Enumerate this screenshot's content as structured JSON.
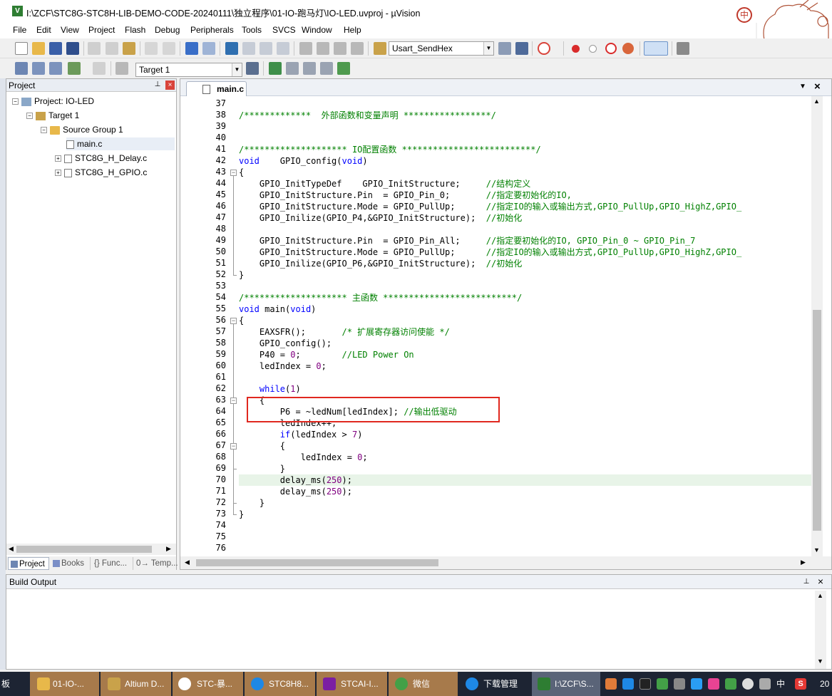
{
  "window": {
    "title": "I:\\ZCF\\STC8G-STC8H-LIB-DEMO-CODE-20240111\\独立程序\\01-IO-跑马灯\\IO-LED.uvproj - µVision",
    "ime": "中",
    "ime2": "⊕"
  },
  "menu": [
    "File",
    "Edit",
    "View",
    "Project",
    "Flash",
    "Debug",
    "Peripherals",
    "Tools",
    "SVCS",
    "Window",
    "Help"
  ],
  "toolbar": {
    "find_combo": "Usart_SendHex",
    "target_combo": "Target 1"
  },
  "project_panel": {
    "title": "Project",
    "pin": "⊥",
    "close": "×",
    "tree": [
      {
        "label": "Project: IO-LED",
        "level": 0,
        "toggle": "−",
        "icon": "project"
      },
      {
        "label": "Target 1",
        "level": 1,
        "toggle": "−",
        "icon": "target"
      },
      {
        "label": "Source Group 1",
        "level": 2,
        "toggle": "−",
        "icon": "folder"
      },
      {
        "label": "main.c",
        "level": 3,
        "toggle": "",
        "icon": "file",
        "selected": true
      },
      {
        "label": "STC8G_H_Delay.c",
        "level": 3,
        "toggle": "+",
        "icon": "file"
      },
      {
        "label": "STC8G_H_GPIO.c",
        "level": 3,
        "toggle": "+",
        "icon": "file"
      }
    ],
    "tabs": [
      "Project",
      "Books",
      "{} Func...",
      "0→ Temp..."
    ]
  },
  "editor": {
    "tab": "main.c",
    "tab_menu": "▼",
    "tab_close": "×",
    "line_numbers": [
      "37",
      "38",
      "39",
      "40",
      "41",
      "42",
      "43",
      "44",
      "45",
      "46",
      "47",
      "48",
      "49",
      "50",
      "51",
      "52",
      "53",
      "54",
      "55",
      "56",
      "57",
      "58",
      "59",
      "60",
      "61",
      "62",
      "63",
      "64",
      "65",
      "66",
      "67",
      "68",
      "69",
      "70",
      "71",
      "72",
      "73",
      "74",
      "75",
      "76"
    ],
    "lines": [
      [],
      [
        [
          "cm",
          "/*************  外部函数和变量声明 *****************/"
        ]
      ],
      [],
      [],
      [
        [
          "cm",
          "/******************** IO配置函数 **************************/"
        ]
      ],
      [
        [
          "kw",
          "void"
        ],
        [
          "",
          "    GPIO_config("
        ],
        [
          "kw",
          "void"
        ],
        [
          "",
          ")"
        ]
      ],
      [
        [
          "",
          "{"
        ]
      ],
      [
        [
          "",
          "    GPIO_InitTypeDef    GPIO_InitStructure;     "
        ],
        [
          "cm",
          "//结构定义"
        ]
      ],
      [
        [
          "",
          "    GPIO_InitStructure.Pin  = GPIO_Pin_0;       "
        ],
        [
          "cm",
          "//指定要初始化的IO,"
        ]
      ],
      [
        [
          "",
          "    GPIO_InitStructure.Mode = GPIO_PullUp;      "
        ],
        [
          "cm",
          "//指定IO的输入或输出方式,GPIO_PullUp,GPIO_HighZ,GPIO_"
        ]
      ],
      [
        [
          "",
          "    GPIO_Inilize(GPIO_P4,&GPIO_InitStructure);  "
        ],
        [
          "cm",
          "//初始化"
        ]
      ],
      [],
      [
        [
          "",
          "    GPIO_InitStructure.Pin  = GPIO_Pin_All;     "
        ],
        [
          "cm",
          "//指定要初始化的IO, GPIO_Pin_0 ~ GPIO_Pin_7"
        ]
      ],
      [
        [
          "",
          "    GPIO_InitStructure.Mode = GPIO_PullUp;      "
        ],
        [
          "cm",
          "//指定IO的输入或输出方式,GPIO_PullUp,GPIO_HighZ,GPIO_"
        ]
      ],
      [
        [
          "",
          "    GPIO_Inilize(GPIO_P6,&GPIO_InitStructure);  "
        ],
        [
          "cm",
          "//初始化"
        ]
      ],
      [
        [
          "",
          "}"
        ]
      ],
      [],
      [
        [
          "cm",
          "/******************** 主函数 **************************/"
        ]
      ],
      [
        [
          "kw",
          "void"
        ],
        [
          "",
          " main("
        ],
        [
          "kw",
          "void"
        ],
        [
          "",
          ")"
        ]
      ],
      [
        [
          "",
          "{"
        ]
      ],
      [
        [
          "",
          "    EAXSFR();       "
        ],
        [
          "cm",
          "/* 扩展寄存器访问使能 */"
        ]
      ],
      [
        [
          "",
          "    GPIO_config();"
        ]
      ],
      [
        [
          "",
          "    P40 = "
        ],
        [
          "num",
          "0"
        ],
        [
          "",
          ";        "
        ],
        [
          "cm",
          "//LED Power On"
        ]
      ],
      [
        [
          "",
          "    ledIndex = "
        ],
        [
          "num",
          "0"
        ],
        [
          "",
          ";"
        ]
      ],
      [],
      [
        [
          "kw",
          "    while"
        ],
        [
          "",
          "("
        ],
        [
          "num",
          "1"
        ],
        [
          "",
          ")"
        ]
      ],
      [
        [
          "",
          "    {"
        ]
      ],
      [
        [
          "",
          "        P6 = ~ledNum[ledIndex]; "
        ],
        [
          "cm",
          "//输出低驱动"
        ]
      ],
      [
        [
          "",
          "        ledIndex++;"
        ]
      ],
      [
        [
          "kw",
          "        if"
        ],
        [
          "",
          "(ledIndex > "
        ],
        [
          "num",
          "7"
        ],
        [
          "",
          ")"
        ]
      ],
      [
        [
          "",
          "        {"
        ]
      ],
      [
        [
          "",
          "            ledIndex = "
        ],
        [
          "num",
          "0"
        ],
        [
          "",
          ";"
        ]
      ],
      [
        [
          "",
          "        }"
        ]
      ],
      [
        [
          "",
          "        delay_ms("
        ],
        [
          "num",
          "250"
        ],
        [
          "",
          ");"
        ]
      ],
      [
        [
          "",
          "        delay_ms("
        ],
        [
          "num",
          "250"
        ],
        [
          "",
          ");"
        ]
      ],
      [
        [
          "",
          "    }"
        ]
      ],
      [
        [
          "",
          "}"
        ]
      ],
      [],
      [],
      []
    ]
  },
  "build_output": {
    "title": "Build Output",
    "pin": "⊥",
    "close": "×"
  },
  "taskbar": {
    "items": [
      {
        "label": "板",
        "color": "#1d2433"
      },
      {
        "label": "01-IO-...",
        "color": "#e8b84a"
      },
      {
        "label": "Altium D...",
        "color": "#c9a24a"
      },
      {
        "label": "STC-暴...",
        "color": "#ffffff"
      },
      {
        "label": "STC8H8...",
        "color": "#1e88e5"
      },
      {
        "label": "STCAI-I...",
        "color": "#7b1fa2"
      },
      {
        "label": "微信",
        "color": "#43a047"
      },
      {
        "label": "下载管理",
        "color": "#1e88e5"
      },
      {
        "label": "I:\\ZCF\\S...",
        "color": "#2e7d32"
      }
    ],
    "tray_lang": "中",
    "tray_s": "S",
    "clock": "20"
  },
  "colors": {
    "comment": "#008000",
    "keyword": "#0000ff",
    "number": "#800080",
    "highlight_box": "#e0281f",
    "taskbar_active": "#a77a4b"
  }
}
